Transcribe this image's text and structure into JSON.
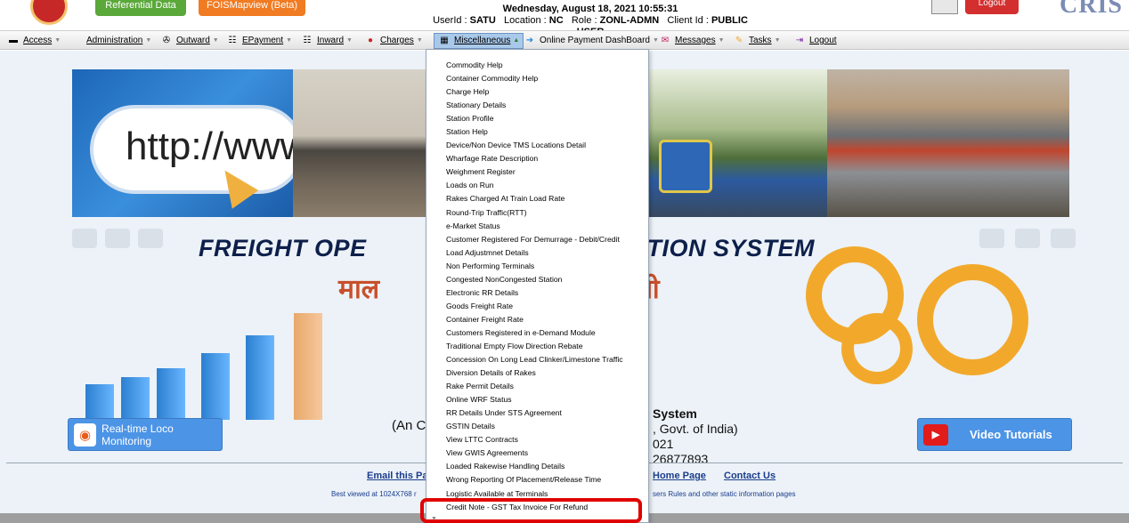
{
  "header": {
    "referential_label": "Referential Data",
    "map_label": "FOISMapview (Beta)",
    "datetime": "Wednesday, August 18, 2021 10:55:31",
    "userid_label": "UserId :",
    "userid": "SATU",
    "location_label": "Location :",
    "location": "NC",
    "role_label": "Role :",
    "role": "ZONL-ADMN",
    "client_label": "Client Id :",
    "client": "PUBLIC USER",
    "logout_label": "Logout",
    "brand": "CRIS"
  },
  "menu": [
    {
      "label": "Access",
      "icon": "access-icon"
    },
    {
      "label": "Administration",
      "icon": ""
    },
    {
      "label": "Outward",
      "icon": "outward-icon"
    },
    {
      "label": "EPayment",
      "icon": "epayment-icon"
    },
    {
      "label": "Inward",
      "icon": "inward-icon"
    },
    {
      "label": "Charges",
      "icon": "charges-icon"
    },
    {
      "label": "Miscellaneous",
      "icon": "misc-icon"
    },
    {
      "label": "Online Payment DashBoard",
      "icon": "dashboard-icon"
    },
    {
      "label": "Messages",
      "icon": "messages-icon"
    },
    {
      "label": "Tasks",
      "icon": "tasks-icon"
    },
    {
      "label": "Logout",
      "icon": "logout-icon"
    }
  ],
  "dropdown": {
    "items": [
      "Commodity Help",
      "Container Commodity Help",
      "Charge Help",
      "Stationary Details",
      "Station Profile",
      "Station Help",
      "Device/Non Device TMS Locations Detail",
      "Wharfage Rate Description",
      "Weighment Register",
      "Loads on Run",
      "Rakes Charged At Train Load Rate",
      "Round-Trip Traffic(RTT)",
      "e-Market Status",
      "Customer Registered For Demurrage - Debit/Credit",
      "Load Adjustmnet Details",
      "Non Performing Terminals",
      "Congested NonCongested Station",
      "Electronic RR Details",
      "Goods Freight Rate",
      "Container Freight Rate",
      "Customers Registered in e-Demand Module",
      "Traditional Empty Flow Direction Rebate",
      "Concession On Long Lead Clinker/Limestone Traffic",
      "Diversion Details of Rakes",
      "Rake Permit Details",
      "Online WRF Status",
      "RR Details Under STS Agreement",
      "GSTIN Details",
      "View LTTC Contracts",
      "View GWIS Agreements",
      "Loaded Rakewise Handling Details",
      "Wrong Reporting Of Placement/Release Time",
      "Logistic Available at Terminals",
      "Credit Note - GST Tax Invoice For Refund"
    ]
  },
  "banner": {
    "http_text": "http://www.",
    "title_en_left": "FREIGHT OPE",
    "title_en_right": "RMATION SYSTEM",
    "title_hi_left": "माल",
    "title_hi_right": "प्रणाली"
  },
  "body": {
    "loco_button": "Real-time Loco Monitoring",
    "video_button": "Video Tutorials",
    "sys_left": "(An C",
    "sys_right_line1": "System",
    "sys_right_line2": ", Govt. of India)",
    "sys_right_line3": "021",
    "sys_right_line4": "26877893"
  },
  "footer": {
    "email_link": "Email this Pa",
    "home_link": "Home Page",
    "contact_link": "Contact Us",
    "best_viewed": "Best viewed at 1024X768 r",
    "rules_text": "sers Rules and other static information pages"
  }
}
